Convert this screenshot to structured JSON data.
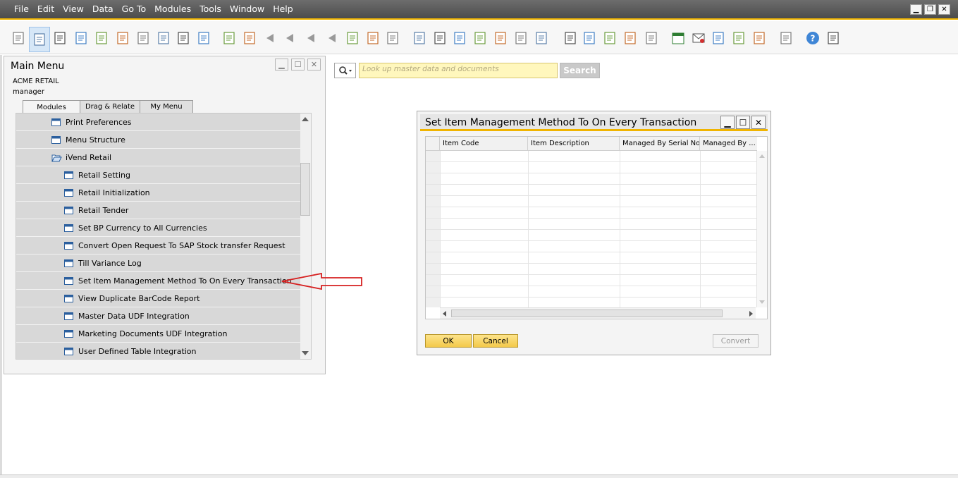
{
  "menubar": {
    "items": [
      "File",
      "Edit",
      "View",
      "Data",
      "Go To",
      "Modules",
      "Tools",
      "Window",
      "Help"
    ]
  },
  "toolbar": {
    "icons": [
      "print-preview-icon",
      "print-icon",
      "email-icon",
      "sms-icon",
      "fax-icon",
      "export-excel-icon",
      "export-word-icon",
      "export-pdf-icon",
      "launch-app-icon",
      "lock-screen-icon",
      "find-icon",
      "add-icon",
      "first-record-icon",
      "previous-record-icon",
      "next-record-icon",
      "last-record-icon",
      "refresh-icon",
      "filter-icon",
      "sort-icon",
      "base-document-icon",
      "target-document-icon",
      "gross-profit-icon",
      "payment-means-icon",
      "volume-weight-icon",
      "journal-voucher-icon",
      "transaction-journal-icon",
      "settings-icon",
      "pen-icon",
      "new-document-icon",
      "doc-settings-icon",
      "messages-icon",
      "alerts-icon",
      "calendar-icon",
      "inbox-icon",
      "report-icon",
      "hierarchy-icon",
      "user-icon",
      "help-icon",
      "widget-a-icon",
      "widget-b-icon"
    ]
  },
  "search": {
    "placeholder": "Look up master data and documents",
    "button_label": "Search"
  },
  "main_menu": {
    "title": "Main Menu",
    "company": "ACME RETAIL",
    "user": "manager",
    "tabs": [
      "Modules",
      "Drag & Relate",
      "My Menu"
    ],
    "items": [
      {
        "label": "Print Preferences",
        "level": 1,
        "type": "doc"
      },
      {
        "label": "Menu Structure",
        "level": 1,
        "type": "doc"
      },
      {
        "label": "iVend Retail",
        "level": 1,
        "type": "folder"
      },
      {
        "label": "Retail Setting",
        "level": 2,
        "type": "doc"
      },
      {
        "label": "Retail Initialization",
        "level": 2,
        "type": "doc"
      },
      {
        "label": "Retail Tender",
        "level": 2,
        "type": "doc"
      },
      {
        "label": "Set BP Currency to All Currencies",
        "level": 2,
        "type": "doc"
      },
      {
        "label": "Convert Open Request To SAP Stock transfer Request",
        "level": 2,
        "type": "doc"
      },
      {
        "label": "Till Variance Log",
        "level": 2,
        "type": "doc"
      },
      {
        "label": "Set Item Management Method To On Every Transaction",
        "level": 2,
        "type": "doc"
      },
      {
        "label": "View Duplicate BarCode Report",
        "level": 2,
        "type": "doc"
      },
      {
        "label": "Master Data UDF Integration",
        "level": 2,
        "type": "doc"
      },
      {
        "label": "Marketing Documents UDF Integration",
        "level": 2,
        "type": "doc"
      },
      {
        "label": "User Defined Table Integration",
        "level": 2,
        "type": "doc"
      }
    ]
  },
  "dialog": {
    "title": "Set Item Management Method To On Every Transaction",
    "columns": [
      "Item Code",
      "Item Description",
      "Managed By Serial No.",
      "Managed By ..."
    ],
    "rows": [],
    "ok_label": "OK",
    "cancel_label": "Cancel",
    "convert_label": "Convert"
  },
  "colors": {
    "accent": "#f0b400",
    "annotation_arrow": "#d62020",
    "tree_row": "#d8d8d8",
    "button_yellow": "#f6cf55"
  }
}
